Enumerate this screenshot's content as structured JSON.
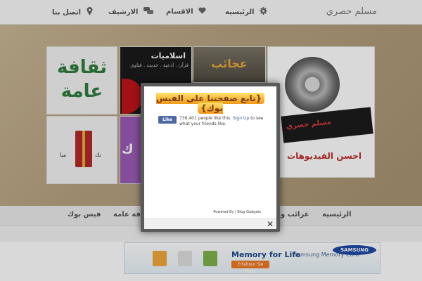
{
  "topbar": {
    "site_title": "مسلم حصري",
    "nav": [
      {
        "label": "الرئيسيه",
        "icon": "gear-icon"
      },
      {
        "label": "الاقسام",
        "icon": "heart-icon"
      },
      {
        "label": "الارشيف",
        "icon": "chat-icon"
      },
      {
        "label": "اتصل بنا",
        "icon": "map-pin-icon"
      }
    ]
  },
  "banner": {
    "culture_line1": "ثقافة",
    "culture_line2": "عامة",
    "islamiyat_title": "اسلاميات",
    "islamiyat_sub": "قرآن . ادعية . حديث . فتاوى",
    "wonders": "عجائب",
    "video_strip": "مسلم حصري",
    "video_bottom": "احسن الفيديوهات",
    "gift_left": "مبا",
    "gift_right": "نك",
    "purple_text": "ك"
  },
  "categories": [
    "الرئيسية",
    "غرائب و",
    "افة عامة",
    "فيس بوك"
  ],
  "ad": {
    "title": "Memory for Life",
    "subtitle": "Samsung Memory Card",
    "cta": "Erfahren Sie mehr",
    "brand": "SAMSUNG"
  },
  "modal": {
    "heading": "{تابع صفحتنا على الفيس بوك}",
    "like_button": "Like",
    "like_count_text": "736,401 people like this.",
    "signup_link": "Sign Up",
    "like_suffix": "to see what your friends like.",
    "powered_by": "Powered By | Blog Gadgets",
    "close_label": "✕"
  }
}
